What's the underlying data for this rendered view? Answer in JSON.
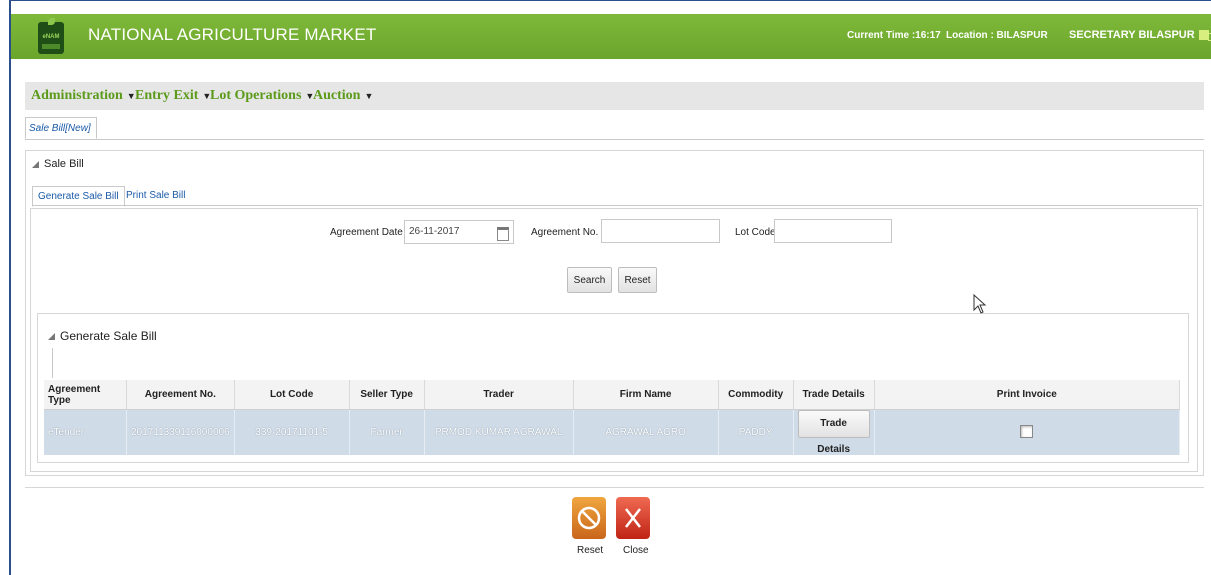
{
  "header": {
    "app_title": "NATIONAL AGRICULTURE MARKET",
    "logo_text": "eNAM",
    "current_time_label": "Current Time :16:17",
    "location_label": "Location : BILASPUR",
    "user": "SECRETARY BILASPUR",
    "accent_color": "#6aa62c"
  },
  "menu": {
    "items": [
      {
        "label": "Administration"
      },
      {
        "label": "Entry Exit"
      },
      {
        "label": "Lot Operations"
      },
      {
        "label": "Auction"
      }
    ]
  },
  "page_tab": {
    "label": "Sale Bill[New]"
  },
  "sale_bill": {
    "section_title": "Sale Bill",
    "tabs": [
      {
        "label": "Generate Sale Bill",
        "active": true
      },
      {
        "label": "Print Sale Bill",
        "active": false
      }
    ],
    "form": {
      "agreement_date_label": "Agreement Date",
      "agreement_date_value": "26-11-2017",
      "agreement_no_label": "Agreement No.",
      "agreement_no_value": "",
      "lot_code_label": "Lot Code",
      "lot_code_value": "",
      "search_label": "Search",
      "reset_label": "Reset"
    }
  },
  "results": {
    "section_title": "Generate Sale Bill",
    "columns": [
      "Agreement Type",
      "Agreement No.",
      "Lot Code",
      "Seller Type",
      "Trader",
      "Firm Name",
      "Commodity",
      "Trade Details",
      "Print Invoice"
    ],
    "rows": [
      {
        "agreement_type": "eTender",
        "agreement_no": "201711339116000006",
        "lot_code": "339-20171101-5",
        "seller_type": "Farmer",
        "trader": "PRMOD KUMAR AGRAWAL",
        "firm_name": "AGRAWAL AGRO",
        "commodity": "PADDY",
        "trade_details_label": "Trade Details",
        "print_invoice_checked": false
      }
    ]
  },
  "footer_actions": {
    "reset_label": "Reset",
    "close_label": "Close",
    "reset_icon": "ban-icon",
    "close_icon": "x-icon"
  }
}
